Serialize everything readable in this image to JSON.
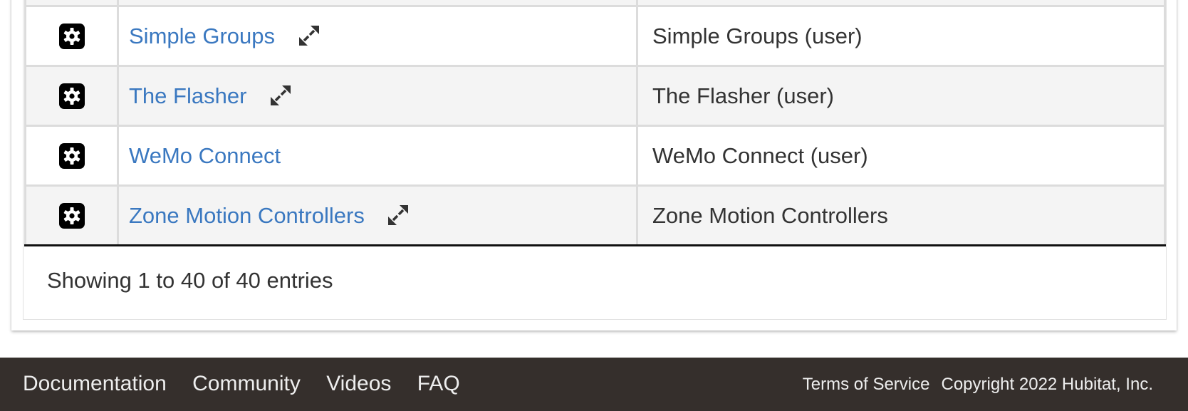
{
  "apps_table": {
    "rows": [
      {
        "name": "Simple Groups",
        "type": "Simple Groups (user)",
        "has_children": true
      },
      {
        "name": "The Flasher",
        "type": "The Flasher (user)",
        "has_children": true
      },
      {
        "name": "WeMo Connect",
        "type": "WeMo Connect (user)",
        "has_children": false
      },
      {
        "name": "Zone Motion Controllers",
        "type": "Zone Motion Controllers",
        "has_children": true
      }
    ],
    "info": "Showing 1 to 40 of 40 entries"
  },
  "footer": {
    "links": [
      "Documentation",
      "Community",
      "Videos",
      "FAQ"
    ],
    "terms": "Terms of Service",
    "copyright": "Copyright 2022 Hubitat, Inc."
  },
  "icons": {
    "row_action": "gear-icon",
    "expand_children": "expand-arrows-icon"
  },
  "colors": {
    "link": "#3a78c0",
    "footer_bg": "#352f2c",
    "row_alt_bg": "#f4f4f4"
  }
}
